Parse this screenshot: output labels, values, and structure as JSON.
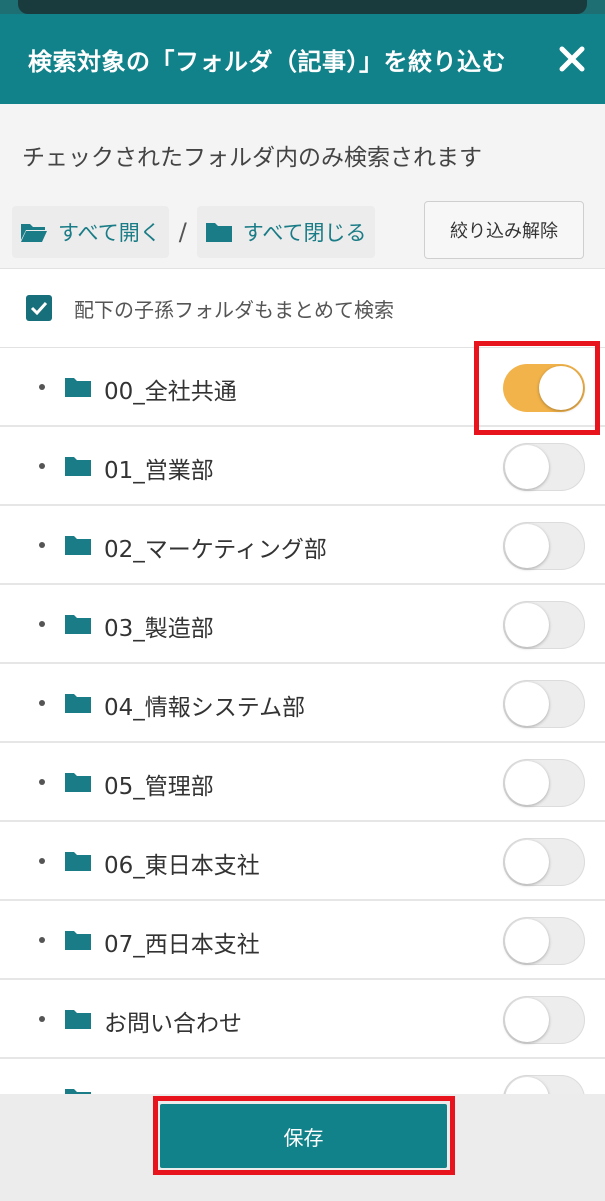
{
  "header": {
    "title": "検索対象の「フォルダ（記事）」を絞り込む",
    "close_icon": "close-icon"
  },
  "description": "チェックされたフォルダ内のみ検索されます",
  "controls": {
    "expand_all": "すべて開く",
    "separator": "/",
    "collapse_all": "すべて閉じる",
    "clear_filter": "絞り込み解除"
  },
  "include_descendants": {
    "label": "配下の子孫フォルダもまとめて検索",
    "checked": true
  },
  "folders": [
    {
      "name": "00_全社共通",
      "enabled": true
    },
    {
      "name": "01_営業部",
      "enabled": false
    },
    {
      "name": "02_マーケティング部",
      "enabled": false
    },
    {
      "name": "03_製造部",
      "enabled": false
    },
    {
      "name": "04_情報システム部",
      "enabled": false
    },
    {
      "name": "05_管理部",
      "enabled": false
    },
    {
      "name": "06_東日本支社",
      "enabled": false
    },
    {
      "name": "07_西日本支社",
      "enabled": false
    },
    {
      "name": "お問い合わせ",
      "enabled": false
    }
  ],
  "footer": {
    "save_label": "保存"
  },
  "colors": {
    "header_bg": "#12828a",
    "accent": "#1a7c86",
    "toggle_on": "#f2b34a",
    "highlight": "#e8141d"
  }
}
